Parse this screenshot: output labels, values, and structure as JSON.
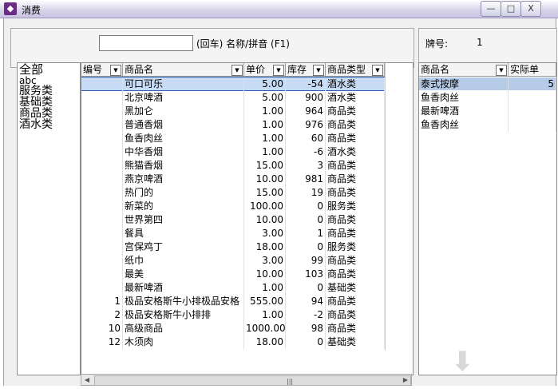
{
  "window": {
    "title": "消费",
    "min_label": "—",
    "max_label": "□",
    "close_label": "X"
  },
  "search": {
    "value": "",
    "hint": "(回车) 名称/拼音 (F1)"
  },
  "plate": {
    "label": "牌号:",
    "value": "1"
  },
  "categories": [
    "全部",
    "abc",
    "服务类",
    "基础类",
    "商品类",
    "酒水类"
  ],
  "grid": {
    "columns": [
      "编号",
      "商品名",
      "单价",
      "库存",
      "商品类型"
    ],
    "rows": [
      [
        "",
        "可口可乐",
        "5.00",
        "-54",
        "酒水类"
      ],
      [
        "",
        "北京啤酒",
        "5.00",
        "900",
        "酒水类"
      ],
      [
        "",
        "黑加仑",
        "1.00",
        "964",
        "商品类"
      ],
      [
        "",
        "普通香烟",
        "1.00",
        "976",
        "商品类"
      ],
      [
        "",
        "鱼香肉丝",
        "1.00",
        "60",
        "商品类"
      ],
      [
        "",
        "中华香烟",
        "1.00",
        "-6",
        "酒水类"
      ],
      [
        "",
        "熊猫香烟",
        "15.00",
        "3",
        "商品类"
      ],
      [
        "",
        "燕京啤酒",
        "10.00",
        "981",
        "商品类"
      ],
      [
        "",
        "热门的",
        "15.00",
        "19",
        "商品类"
      ],
      [
        "",
        "新菜的",
        "100.00",
        "0",
        "服务类"
      ],
      [
        "",
        "世界第四",
        "10.00",
        "0",
        "商品类"
      ],
      [
        "",
        "餐具",
        "3.00",
        "1",
        "商品类"
      ],
      [
        "",
        "宫保鸡丁",
        "18.00",
        "0",
        "服务类"
      ],
      [
        "",
        "纸巾",
        "3.00",
        "99",
        "商品类"
      ],
      [
        "",
        "最美",
        "10.00",
        "103",
        "商品类"
      ],
      [
        "",
        "最新啤酒",
        "1.00",
        "0",
        "基础类"
      ],
      [
        "1",
        "极品安格斯牛小排极品安格",
        "555.00",
        "94",
        "商品类"
      ],
      [
        "2",
        "极品安格斯牛小排排",
        "1.00",
        "-2",
        "商品类"
      ],
      [
        "10",
        "高级商品",
        "1000.00",
        "98",
        "商品类"
      ],
      [
        "12",
        "木须肉",
        "18.00",
        "0",
        "基础类"
      ]
    ]
  },
  "order": {
    "columns": [
      "商品名",
      "实际单"
    ],
    "rows": [
      [
        "泰式按摩",
        "5"
      ],
      [
        "鱼香肉丝",
        ""
      ],
      [
        "最新啤酒",
        ""
      ],
      [
        "鱼香肉丝",
        ""
      ]
    ]
  }
}
